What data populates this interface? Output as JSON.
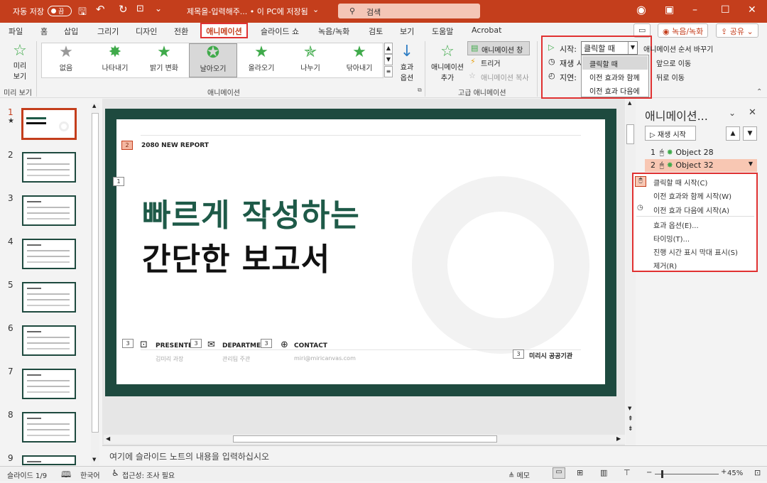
{
  "title_bar": {
    "autosave_label": "자동 저장",
    "autosave_state": "끔",
    "doc_title": "제목을-입력해주... • 이 PC에 저장됨",
    "search_placeholder": "검색"
  },
  "tabs": [
    "파일",
    "홈",
    "삽입",
    "그리기",
    "디자인",
    "전환",
    "애니메이션",
    "슬라이드 쇼",
    "녹음/녹화",
    "검토",
    "보기",
    "도움말",
    "Acrobat"
  ],
  "active_tab": "애니메이션",
  "header_buttons": {
    "record": "녹음/녹화",
    "share": "공유"
  },
  "ribbon": {
    "preview": {
      "label": "미리 보기",
      "group": "미리 보기"
    },
    "effects": [
      "없음",
      "나타내기",
      "밝기 변화",
      "날아오기",
      "올라오기",
      "나누기",
      "닦아내기"
    ],
    "selected_effect": "날아오기",
    "effect_options": "효과 옵션",
    "animation_group": "애니메이션",
    "advanced": {
      "add_animation": "애니메이션 추가",
      "pane": "애니메이션 창",
      "trigger": "트리거",
      "painter": "애니메이션 복사",
      "group": "고급 애니메이션"
    },
    "timing": {
      "start_label": "시작:",
      "start_value": "클릭할 때",
      "duration_label": "재생 시",
      "delay_label": "지연:",
      "dropdown_options": [
        "클릭할 때",
        "이전 효과와 함께",
        "이전 효과 다음에"
      ],
      "reorder": "애니메이션 순서 바꾸기",
      "move_earlier": "앞으로 이동",
      "move_later": "뒤로 이동"
    }
  },
  "thumbnails": [
    "1",
    "2",
    "3",
    "4",
    "5",
    "6",
    "7",
    "8",
    "9"
  ],
  "thumb_star": "★",
  "slide": {
    "tag": "2",
    "report": "2080 NEW REPORT",
    "tag_title": "1",
    "title_line1": "빠르게 작성하는",
    "title_line2": "간단한 보고서",
    "tag_footer": "3",
    "presenter": "PRESENTER",
    "presenter_sub": "김미리 과장",
    "department": "DEPARTMENT",
    "department_sub": "관리팀 주관",
    "contact": "CONTACT",
    "contact_sub": "miri@miricanvas.com",
    "org": "미리시 공공기관"
  },
  "anim_pane": {
    "title": "애니메이션...",
    "play": "재생 시작",
    "items": [
      {
        "num": "1",
        "name": "Object 28"
      },
      {
        "num": "2",
        "name": "Object 32"
      }
    ],
    "context_menu": [
      "클릭할 때 시작(C)",
      "이전 효과와 함께 시작(W)",
      "이전 효과 다음에 시작(A)",
      "효과 옵션(E)...",
      "타이밍(T)...",
      "진행 시간 표시 막대 표시(S)",
      "제거(R)"
    ]
  },
  "notes_placeholder": "여기에 슬라이드 노트의 내용을 입력하십시오",
  "status": {
    "slide": "슬라이드 1/9",
    "language": "한국어",
    "accessibility": "접근성: 조사 필요",
    "notes": "메모",
    "zoom": "45%"
  },
  "colors": {
    "brand": "#c43e1c",
    "slide_green": "#1e4a3f",
    "highlight": "#e03131"
  }
}
